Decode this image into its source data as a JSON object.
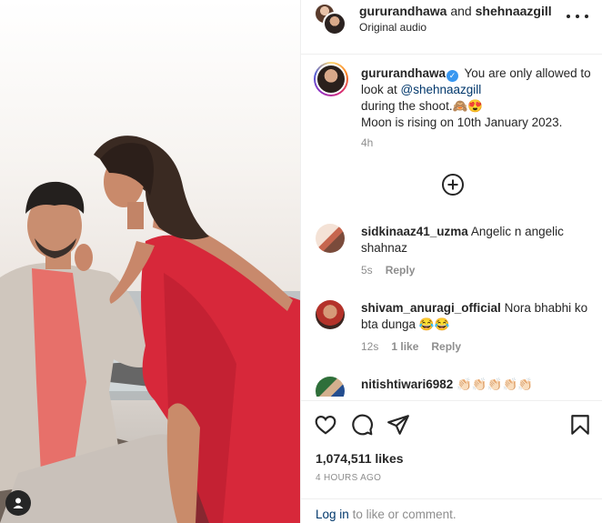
{
  "header": {
    "user1": "gururandhawa",
    "and_text": "and",
    "user2": "shehnaazgill",
    "audio": "Original audio"
  },
  "caption": {
    "username": "gururandhawa",
    "text_before_mention": "You are only allowed to look at",
    "mention": "@shehnaazgill",
    "text_after_mention": "during the shoot.🙈😍",
    "line2": "Moon is rising on 10th January 2023.",
    "time": "4h"
  },
  "comments": [
    {
      "username": "sidkinaaz41_uzma",
      "text": "Angelic n angelic shahnaz",
      "time": "5s",
      "likes": "",
      "reply": "Reply"
    },
    {
      "username": "shivam_anuragi_official",
      "text": "Nora bhabhi ko bta dunga 😂😂",
      "time": "12s",
      "likes": "1 like",
      "reply": "Reply"
    },
    {
      "username": "nitishtiwari6982",
      "text": "👏🏻👏🏻👏🏻👏🏻👏🏻",
      "time": "",
      "likes": "",
      "reply": ""
    }
  ],
  "actions": {
    "icons": [
      "heart-icon",
      "comment-icon",
      "share-icon",
      "bookmark-icon"
    ]
  },
  "likes_count": "1,074,511 likes",
  "post_age": "4 HOURS AGO",
  "login": {
    "link": "Log in",
    "rest": "to like or comment."
  },
  "colors": {
    "accent": "#0095f6",
    "link": "#00376b",
    "muted": "#8e8e8e",
    "dress_red": "#d7283a",
    "verified": "#3897f0"
  }
}
